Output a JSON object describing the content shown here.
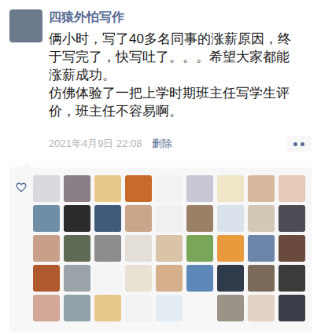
{
  "author": {
    "name": "四猿外怕写作"
  },
  "post": {
    "lines": [
      "俩小时，写了40多名同事的涨薪原因，终",
      "于写完了，快写吐了。。。希望大家都能",
      "涨薪成功。",
      "仿佛体验了一把上学时期班主任写学生评",
      "价，班主任不容易啊。"
    ]
  },
  "meta": {
    "time": "2021年4月9日 22:08",
    "delete": "删除"
  },
  "likes": {
    "likers": [
      {
        "color": "#d9d9df"
      },
      {
        "color": "#8a7f86"
      },
      {
        "color": "#e8c98a"
      },
      {
        "color": "#c86a2a"
      },
      {
        "color": "#f2f2f2"
      },
      {
        "color": "#c9c7d6"
      },
      {
        "color": "#efe6c8"
      },
      {
        "color": "#d8b79c"
      },
      {
        "color": "#e6c9b8"
      },
      {
        "color": "#6f8ea6"
      },
      {
        "color": "#2b2b2b"
      },
      {
        "color": "#3f5a7a"
      },
      {
        "color": "#c9a58a"
      },
      {
        "color": "#f0f0f0"
      },
      {
        "color": "#9a8066"
      },
      {
        "color": "#d9e1ea"
      },
      {
        "color": "#d2c8b5"
      },
      {
        "color": "#4e4c54"
      },
      {
        "color": "#c8a089"
      },
      {
        "color": "#5f6b55"
      },
      {
        "color": "#8d8d8d"
      },
      {
        "color": "#e3dfd8"
      },
      {
        "color": "#d9c4a8"
      },
      {
        "color": "#7aa65a"
      },
      {
        "color": "#e89a3c"
      },
      {
        "color": "#6b86a8"
      },
      {
        "color": "#6a4a3c"
      },
      {
        "color": "#b0582e"
      },
      {
        "color": "#9aa3a8"
      },
      {
        "color": "#f4f4f4"
      },
      {
        "color": "#e8e2d4"
      },
      {
        "color": "#d6b08c"
      },
      {
        "color": "#5d88b8"
      },
      {
        "color": "#2f3a4a"
      },
      {
        "color": "#7a6a5a"
      },
      {
        "color": "#3b3b3b"
      },
      {
        "color": "#d4a898"
      },
      {
        "color": "#8fa3a8"
      },
      {
        "color": "#e8c88a"
      },
      {
        "color": "#f2f2f2"
      },
      {
        "color": "#e4ecf4"
      },
      {
        "color": "#f6f6f6"
      },
      {
        "color": "#9a9488"
      },
      {
        "color": "#e4d2c4"
      },
      {
        "color": "#3a3f4a"
      }
    ]
  }
}
